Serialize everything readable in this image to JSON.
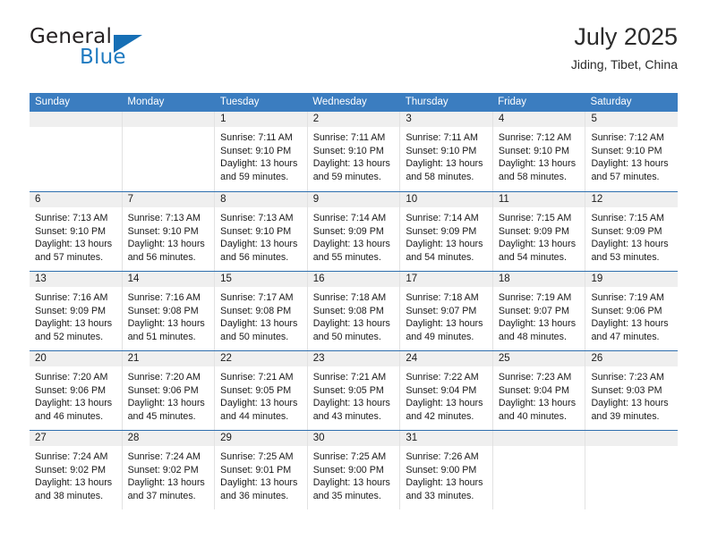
{
  "brand": {
    "name_top": "General",
    "name_bottom": "Blue",
    "triangle_icon": "blue-triangle-logo",
    "color_dark": "#231f20",
    "color_blue": "#1f7ac0"
  },
  "header": {
    "title": "July 2025",
    "subtitle": "Jiding, Tibet, China"
  },
  "theme": {
    "header_bg": "#3b7dc0",
    "header_text": "#ffffff",
    "row_divider": "#2f6fae",
    "daynum_band": "#efefef",
    "cell_divider": "#e2e2e2"
  },
  "weekdays": [
    "Sunday",
    "Monday",
    "Tuesday",
    "Wednesday",
    "Thursday",
    "Friday",
    "Saturday"
  ],
  "weeks": [
    [
      {
        "day": "",
        "lines": []
      },
      {
        "day": "",
        "lines": []
      },
      {
        "day": "1",
        "lines": [
          "Sunrise: 7:11 AM",
          "Sunset: 9:10 PM",
          "Daylight: 13 hours",
          "and 59 minutes."
        ]
      },
      {
        "day": "2",
        "lines": [
          "Sunrise: 7:11 AM",
          "Sunset: 9:10 PM",
          "Daylight: 13 hours",
          "and 59 minutes."
        ]
      },
      {
        "day": "3",
        "lines": [
          "Sunrise: 7:11 AM",
          "Sunset: 9:10 PM",
          "Daylight: 13 hours",
          "and 58 minutes."
        ]
      },
      {
        "day": "4",
        "lines": [
          "Sunrise: 7:12 AM",
          "Sunset: 9:10 PM",
          "Daylight: 13 hours",
          "and 58 minutes."
        ]
      },
      {
        "day": "5",
        "lines": [
          "Sunrise: 7:12 AM",
          "Sunset: 9:10 PM",
          "Daylight: 13 hours",
          "and 57 minutes."
        ]
      }
    ],
    [
      {
        "day": "6",
        "lines": [
          "Sunrise: 7:13 AM",
          "Sunset: 9:10 PM",
          "Daylight: 13 hours",
          "and 57 minutes."
        ]
      },
      {
        "day": "7",
        "lines": [
          "Sunrise: 7:13 AM",
          "Sunset: 9:10 PM",
          "Daylight: 13 hours",
          "and 56 minutes."
        ]
      },
      {
        "day": "8",
        "lines": [
          "Sunrise: 7:13 AM",
          "Sunset: 9:10 PM",
          "Daylight: 13 hours",
          "and 56 minutes."
        ]
      },
      {
        "day": "9",
        "lines": [
          "Sunrise: 7:14 AM",
          "Sunset: 9:09 PM",
          "Daylight: 13 hours",
          "and 55 minutes."
        ]
      },
      {
        "day": "10",
        "lines": [
          "Sunrise: 7:14 AM",
          "Sunset: 9:09 PM",
          "Daylight: 13 hours",
          "and 54 minutes."
        ]
      },
      {
        "day": "11",
        "lines": [
          "Sunrise: 7:15 AM",
          "Sunset: 9:09 PM",
          "Daylight: 13 hours",
          "and 54 minutes."
        ]
      },
      {
        "day": "12",
        "lines": [
          "Sunrise: 7:15 AM",
          "Sunset: 9:09 PM",
          "Daylight: 13 hours",
          "and 53 minutes."
        ]
      }
    ],
    [
      {
        "day": "13",
        "lines": [
          "Sunrise: 7:16 AM",
          "Sunset: 9:09 PM",
          "Daylight: 13 hours",
          "and 52 minutes."
        ]
      },
      {
        "day": "14",
        "lines": [
          "Sunrise: 7:16 AM",
          "Sunset: 9:08 PM",
          "Daylight: 13 hours",
          "and 51 minutes."
        ]
      },
      {
        "day": "15",
        "lines": [
          "Sunrise: 7:17 AM",
          "Sunset: 9:08 PM",
          "Daylight: 13 hours",
          "and 50 minutes."
        ]
      },
      {
        "day": "16",
        "lines": [
          "Sunrise: 7:18 AM",
          "Sunset: 9:08 PM",
          "Daylight: 13 hours",
          "and 50 minutes."
        ]
      },
      {
        "day": "17",
        "lines": [
          "Sunrise: 7:18 AM",
          "Sunset: 9:07 PM",
          "Daylight: 13 hours",
          "and 49 minutes."
        ]
      },
      {
        "day": "18",
        "lines": [
          "Sunrise: 7:19 AM",
          "Sunset: 9:07 PM",
          "Daylight: 13 hours",
          "and 48 minutes."
        ]
      },
      {
        "day": "19",
        "lines": [
          "Sunrise: 7:19 AM",
          "Sunset: 9:06 PM",
          "Daylight: 13 hours",
          "and 47 minutes."
        ]
      }
    ],
    [
      {
        "day": "20",
        "lines": [
          "Sunrise: 7:20 AM",
          "Sunset: 9:06 PM",
          "Daylight: 13 hours",
          "and 46 minutes."
        ]
      },
      {
        "day": "21",
        "lines": [
          "Sunrise: 7:20 AM",
          "Sunset: 9:06 PM",
          "Daylight: 13 hours",
          "and 45 minutes."
        ]
      },
      {
        "day": "22",
        "lines": [
          "Sunrise: 7:21 AM",
          "Sunset: 9:05 PM",
          "Daylight: 13 hours",
          "and 44 minutes."
        ]
      },
      {
        "day": "23",
        "lines": [
          "Sunrise: 7:21 AM",
          "Sunset: 9:05 PM",
          "Daylight: 13 hours",
          "and 43 minutes."
        ]
      },
      {
        "day": "24",
        "lines": [
          "Sunrise: 7:22 AM",
          "Sunset: 9:04 PM",
          "Daylight: 13 hours",
          "and 42 minutes."
        ]
      },
      {
        "day": "25",
        "lines": [
          "Sunrise: 7:23 AM",
          "Sunset: 9:04 PM",
          "Daylight: 13 hours",
          "and 40 minutes."
        ]
      },
      {
        "day": "26",
        "lines": [
          "Sunrise: 7:23 AM",
          "Sunset: 9:03 PM",
          "Daylight: 13 hours",
          "and 39 minutes."
        ]
      }
    ],
    [
      {
        "day": "27",
        "lines": [
          "Sunrise: 7:24 AM",
          "Sunset: 9:02 PM",
          "Daylight: 13 hours",
          "and 38 minutes."
        ]
      },
      {
        "day": "28",
        "lines": [
          "Sunrise: 7:24 AM",
          "Sunset: 9:02 PM",
          "Daylight: 13 hours",
          "and 37 minutes."
        ]
      },
      {
        "day": "29",
        "lines": [
          "Sunrise: 7:25 AM",
          "Sunset: 9:01 PM",
          "Daylight: 13 hours",
          "and 36 minutes."
        ]
      },
      {
        "day": "30",
        "lines": [
          "Sunrise: 7:25 AM",
          "Sunset: 9:00 PM",
          "Daylight: 13 hours",
          "and 35 minutes."
        ]
      },
      {
        "day": "31",
        "lines": [
          "Sunrise: 7:26 AM",
          "Sunset: 9:00 PM",
          "Daylight: 13 hours",
          "and 33 minutes."
        ]
      },
      {
        "day": "",
        "lines": []
      },
      {
        "day": "",
        "lines": []
      }
    ]
  ]
}
